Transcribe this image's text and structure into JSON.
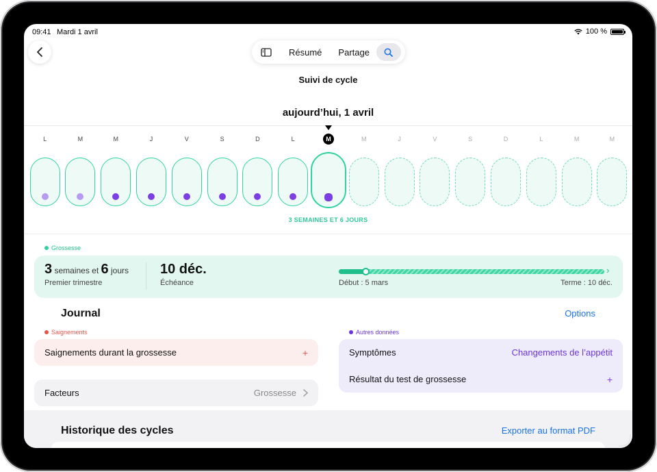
{
  "status_bar": {
    "time": "09:41",
    "date": "Mardi 1 avril",
    "battery": "100 %"
  },
  "toolbar": {
    "summary_label": "Résumé",
    "share_label": "Partage"
  },
  "page": {
    "title": "Suivi de cycle",
    "today_label": "aujourd’hui, 1 avril"
  },
  "calendar": {
    "days": [
      {
        "letter": "L",
        "state": "past",
        "dot": "light"
      },
      {
        "letter": "M",
        "state": "past",
        "dot": "light"
      },
      {
        "letter": "M",
        "state": "past",
        "dot": "dark"
      },
      {
        "letter": "J",
        "state": "past",
        "dot": "dark"
      },
      {
        "letter": "V",
        "state": "past",
        "dot": "dark"
      },
      {
        "letter": "S",
        "state": "past",
        "dot": "dark"
      },
      {
        "letter": "D",
        "state": "past",
        "dot": "dark"
      },
      {
        "letter": "L",
        "state": "past",
        "dot": "dark"
      },
      {
        "letter": "M",
        "state": "today",
        "dot": "dark"
      },
      {
        "letter": "M",
        "state": "future",
        "dot": ""
      },
      {
        "letter": "J",
        "state": "future",
        "dot": ""
      },
      {
        "letter": "V",
        "state": "future",
        "dot": ""
      },
      {
        "letter": "S",
        "state": "future",
        "dot": ""
      },
      {
        "letter": "D",
        "state": "future",
        "dot": ""
      },
      {
        "letter": "L",
        "state": "future",
        "dot": ""
      },
      {
        "letter": "M",
        "state": "future",
        "dot": ""
      },
      {
        "letter": "M",
        "state": "future",
        "dot": ""
      }
    ],
    "duration_caption": "3 SEMAINES ET 6 JOURS"
  },
  "pregnancy": {
    "tag": "Grossesse",
    "weeks": "3",
    "weeks_unit": "semaines et",
    "days": "6",
    "days_unit": "jours",
    "trimester": "Premier trimestre",
    "due_date": "10 déc.",
    "due_label": "Échéance",
    "start_label": "Début : 5 mars",
    "end_label": "Terme : 10 déc.",
    "progress_fraction": 0.1
  },
  "journal": {
    "title": "Journal",
    "options_label": "Options",
    "bleeding_tag": "Saignements",
    "bleeding_row": "Saignements durant la grossesse",
    "factors_row": "Facteurs",
    "factors_value": "Grossesse",
    "other_tag": "Autres données",
    "symptoms_row": "Symptômes",
    "symptoms_value": "Changements de l’appétit",
    "test_row": "Résultat du test de grossesse",
    "plus": "+"
  },
  "history": {
    "title": "Historique des cycles",
    "export_label": "Exporter au format PDF"
  },
  "colors": {
    "accent_green": "#2fd3a0",
    "bleeding": "#e2574c",
    "other": "#7b3fe4",
    "link": "#1a73e8"
  }
}
